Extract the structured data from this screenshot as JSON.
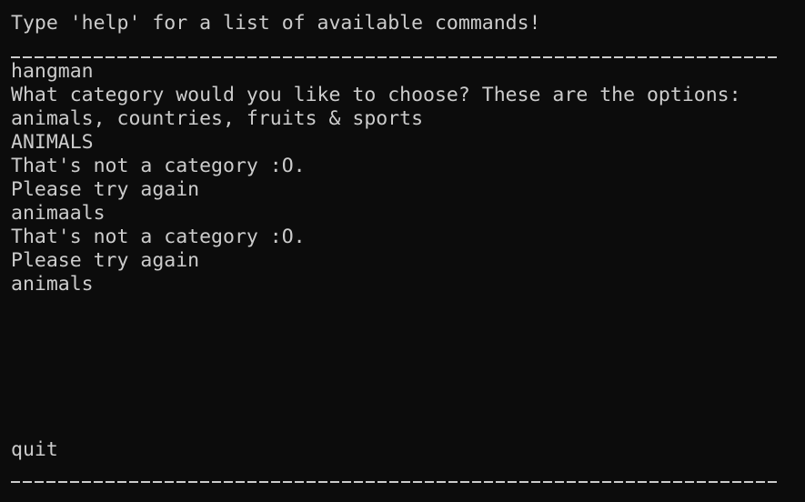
{
  "terminal": {
    "header": "Type 'help' for a list of available commands!",
    "lines": [
      "hangman",
      "What category would you like to choose? These are the options:",
      "animals, countries, fruits & sports",
      "ANIMALS",
      "That's not a category :O.",
      "Please try again",
      "animaals",
      "That's not a category :O.",
      "Please try again",
      "animals"
    ],
    "input_line": "quit"
  },
  "colors": {
    "background": "#0c0c0c",
    "text": "#cccccc"
  }
}
